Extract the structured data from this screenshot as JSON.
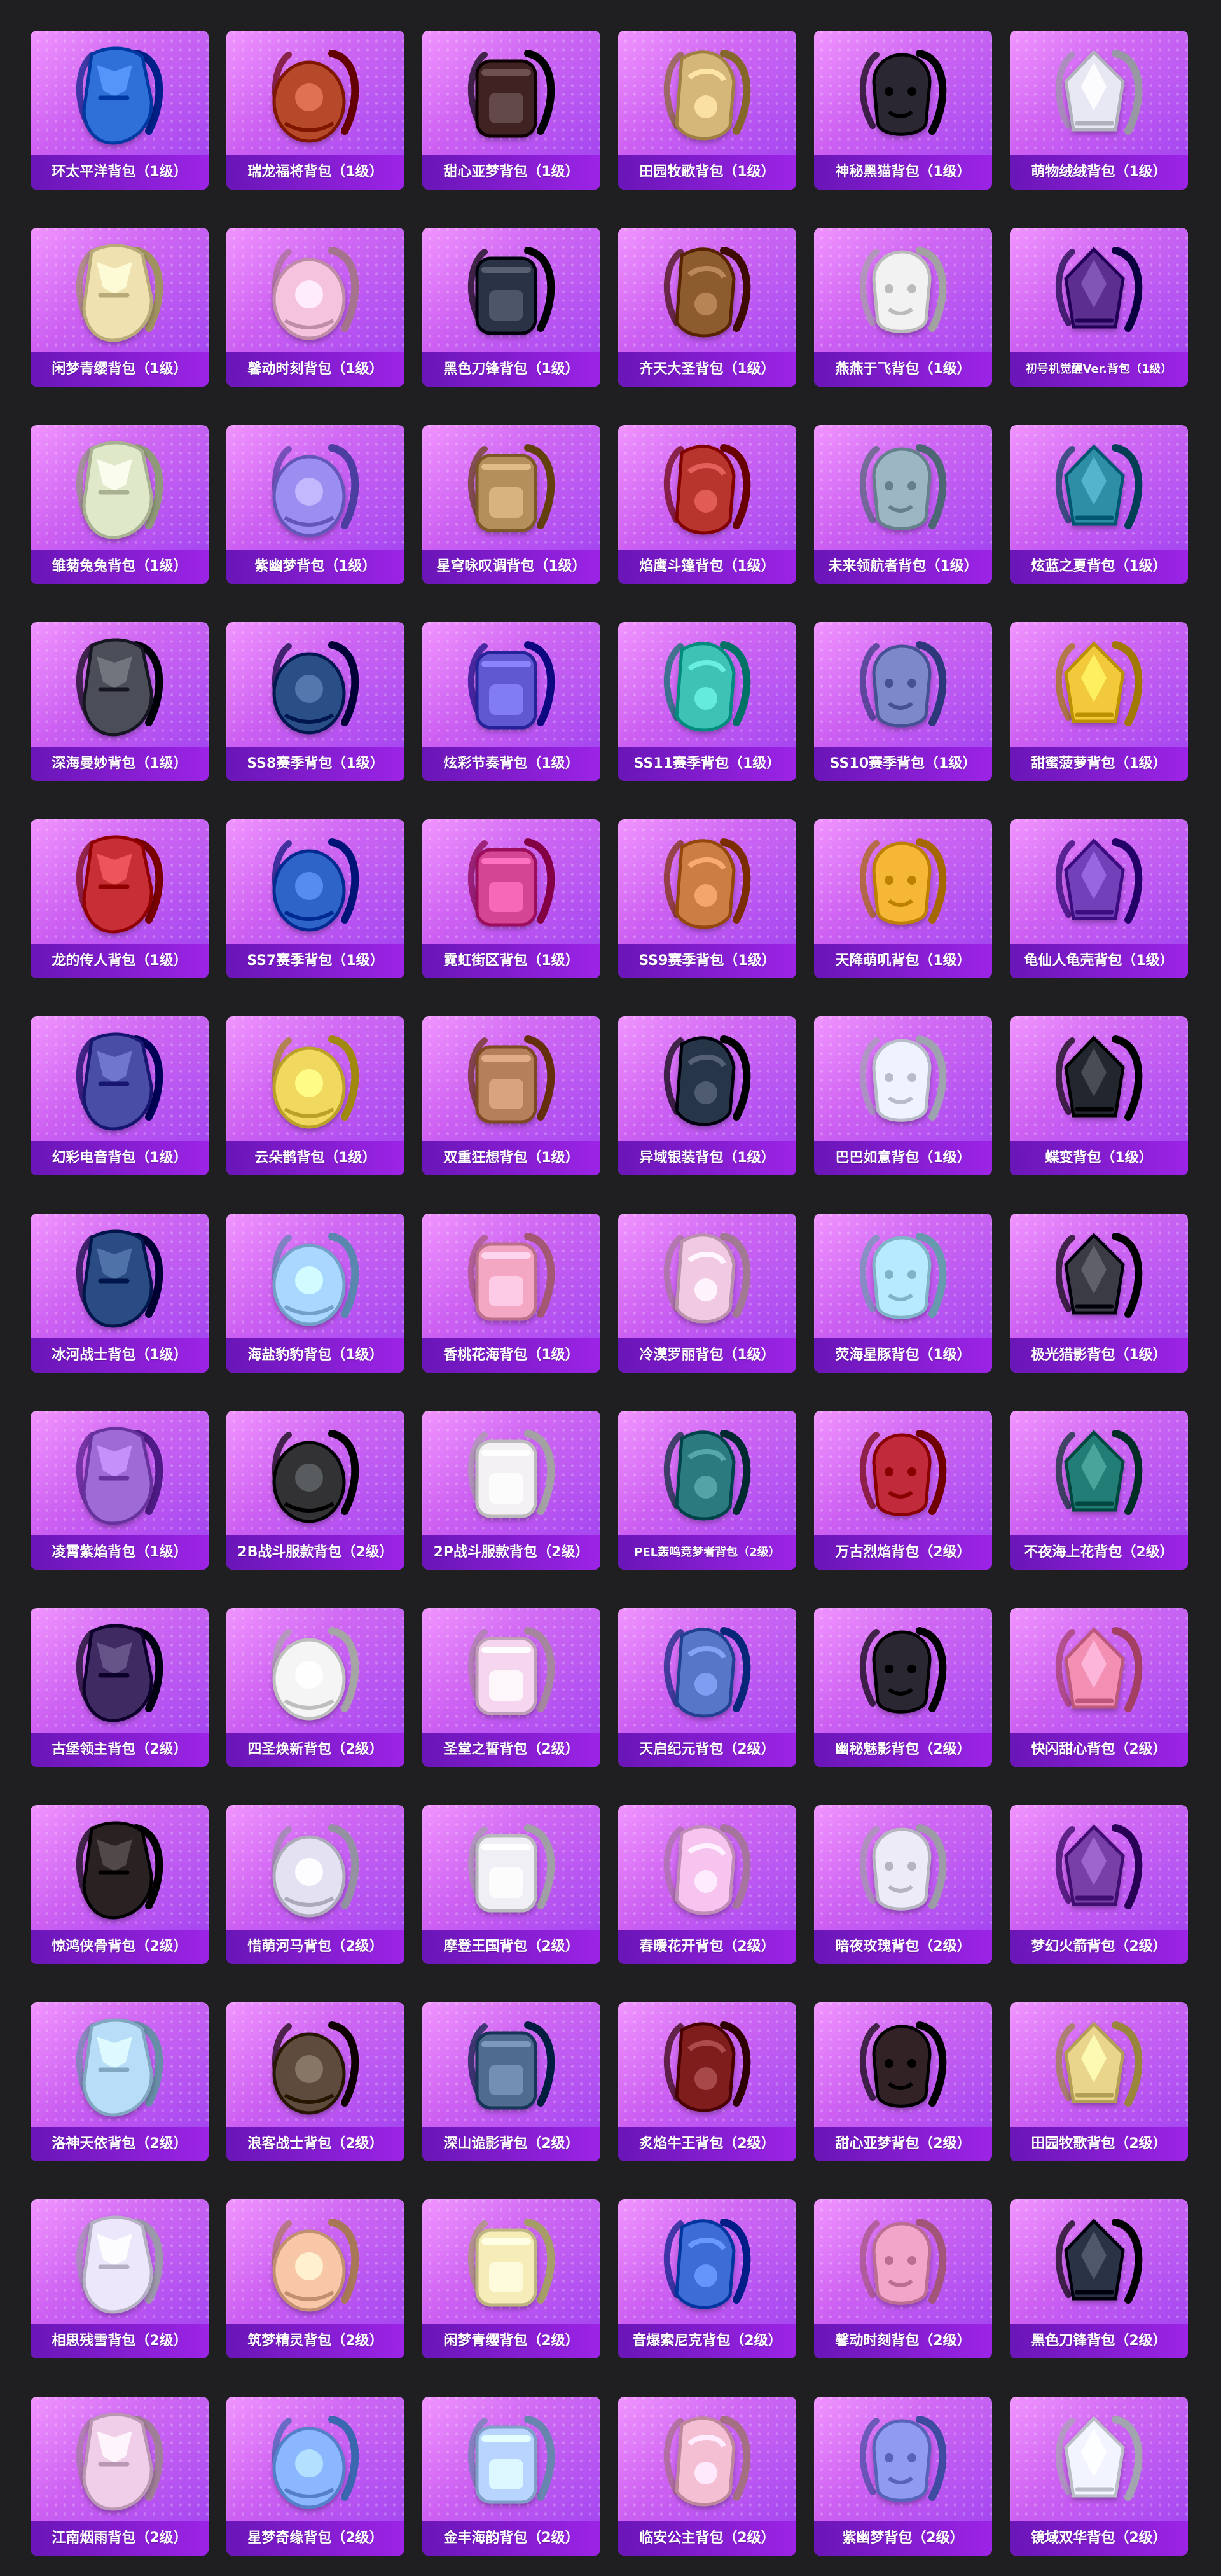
{
  "items": [
    {
      "label": "环太平洋背包（1级）",
      "icon": "armored-backpack-icon",
      "accent": "#2f6fd8"
    },
    {
      "label": "瑞龙福将背包（1级）",
      "icon": "dragon-backpack-icon",
      "accent": "#b54a2b"
    },
    {
      "label": "甜心亚梦背包（1级）",
      "icon": "cat-backpack-icon",
      "accent": "#402424"
    },
    {
      "label": "田园牧歌背包（1级）",
      "icon": "basket-backpack-icon",
      "accent": "#d6b77a"
    },
    {
      "label": "神秘黑猫背包（1级）",
      "icon": "black-cat-backpack-icon",
      "accent": "#2c2830"
    },
    {
      "label": "萌物绒绒背包（1级）",
      "icon": "plush-backpack-icon",
      "accent": "#e8e8f5"
    },
    {
      "label": "闲梦青缨背包（1级）",
      "icon": "tassel-backpack-icon",
      "accent": "#f0e2b0"
    },
    {
      "label": "馨动时刻背包（1级）",
      "icon": "bunny-backpack-icon",
      "accent": "#f5c3dd"
    },
    {
      "label": "黑色刀锋背包（1级）",
      "icon": "blade-backpack-icon",
      "accent": "#2b3244"
    },
    {
      "label": "齐天大圣背包（1级）",
      "icon": "monkey-king-backpack-icon",
      "accent": "#8d5b2d"
    },
    {
      "label": "燕燕于飞背包（1级）",
      "icon": "swallow-backpack-icon",
      "accent": "#f2f2f2"
    },
    {
      "label": "初号机觉醒Ver.背包（1级）",
      "icon": "mecha-backpack-icon",
      "accent": "#5b2f8f"
    },
    {
      "label": "雏菊兔兔背包（1级）",
      "icon": "daisy-bunny-backpack-icon",
      "accent": "#dfe8c8"
    },
    {
      "label": "紫幽梦背包（1级）",
      "icon": "purple-orb-backpack-icon",
      "accent": "#9b8ef0"
    },
    {
      "label": "星穹咏叹调背包（1级）",
      "icon": "golden-backpack-icon",
      "accent": "#b38f5c"
    },
    {
      "label": "焰鹰斗篷背包（1级）",
      "icon": "flame-cape-backpack-icon",
      "accent": "#b8342d"
    },
    {
      "label": "未来领航者背包（1级）",
      "icon": "future-pilot-backpack-icon",
      "accent": "#9db6c4"
    },
    {
      "label": "炫蓝之夏背包（1级）",
      "icon": "blue-summer-backpack-icon",
      "accent": "#2e8ea6"
    },
    {
      "label": "深海曼妙背包（1级）",
      "icon": "tank-backpack-icon",
      "accent": "#4b4e58"
    },
    {
      "label": "SS8赛季背包（1级）",
      "icon": "season-backpack-icon",
      "accent": "#2b4f86"
    },
    {
      "label": "炫彩节奏背包（1级）",
      "icon": "rhythm-backpack-icon",
      "accent": "#5e58d0"
    },
    {
      "label": "SS11赛季背包（1级）",
      "icon": "season-backpack-icon",
      "accent": "#3cc2b5"
    },
    {
      "label": "SS10赛季背包（1级）",
      "icon": "season-backpack-icon",
      "accent": "#7c88c9"
    },
    {
      "label": "甜蜜菠萝背包（1级）",
      "icon": "pineapple-backpack-icon",
      "accent": "#f1c93b"
    },
    {
      "label": "龙的传人背包（1级）",
      "icon": "red-school-backpack-icon",
      "accent": "#c82f34"
    },
    {
      "label": "SS7赛季背包（1级）",
      "icon": "season-backpack-icon",
      "accent": "#2e63c7"
    },
    {
      "label": "霓虹街区背包（1级）",
      "icon": "neon-backpack-icon",
      "accent": "#d44594"
    },
    {
      "label": "SS9赛季背包（1级）",
      "icon": "season-backpack-icon",
      "accent": "#cb7d42"
    },
    {
      "label": "天降萌叽背包（1级）",
      "icon": "yellow-backpack-icon",
      "accent": "#f5b735"
    },
    {
      "label": "龟仙人龟壳背包（1级）",
      "icon": "turtle-shell-backpack-icon",
      "accent": "#7240b8"
    },
    {
      "label": "幻彩电音背包（1级）",
      "icon": "speaker-backpack-icon",
      "accent": "#4a4ea6"
    },
    {
      "label": "云朵鹊背包（1级）",
      "icon": "flower-backpack-icon",
      "accent": "#f1d95f"
    },
    {
      "label": "双重狂想背包（1级）",
      "icon": "fox-backpack-icon",
      "accent": "#b47f5a"
    },
    {
      "label": "异域银装背包（1级）",
      "icon": "silver-backpack-icon",
      "accent": "#273447"
    },
    {
      "label": "巴巴如意背包（1级）",
      "icon": "white-bunny-backpack-icon",
      "accent": "#eef3ff"
    },
    {
      "label": "蝶变背包（1级）",
      "icon": "butterfly-backpack-icon",
      "accent": "#23252f"
    },
    {
      "label": "冰河战士背包（1级）",
      "icon": "ice-warrior-backpack-icon",
      "accent": "#2a4c83"
    },
    {
      "label": "海盐豹豹背包（1级）",
      "icon": "seal-backpack-icon",
      "accent": "#a9d7ff"
    },
    {
      "label": "香桃花海背包（1级）",
      "icon": "peach-backpack-icon",
      "accent": "#f4a7c2"
    },
    {
      "label": "冷漠罗丽背包（1级）",
      "icon": "ribbon-backpack-icon",
      "accent": "#f2c9e2"
    },
    {
      "label": "荧海星豚背包（1级）",
      "icon": "dolphin-backpack-icon",
      "accent": "#b8eaff"
    },
    {
      "label": "极光猎影背包（1级）",
      "icon": "shadow-backpack-icon",
      "accent": "#3b3b45"
    },
    {
      "label": "凌霄紫焰背包（1级）",
      "icon": "purple-flame-backpack-icon",
      "accent": "#9e6ad5"
    },
    {
      "label": "2B战斗服款背包（2级）",
      "icon": "combat-backpack-icon",
      "accent": "#303236"
    },
    {
      "label": "2P战斗服款背包（2级）",
      "icon": "white-combat-backpack-icon",
      "accent": "#f4f1f4"
    },
    {
      "label": "PEL轰鸣竞梦者背包（2级）",
      "icon": "esports-backpack-icon",
      "accent": "#2a7a7f"
    },
    {
      "label": "万古烈焰背包（2级）",
      "icon": "red-armor-backpack-icon",
      "accent": "#c02b3a"
    },
    {
      "label": "不夜海上花背包（2级）",
      "icon": "teal-flower-backpack-icon",
      "accent": "#227d76"
    },
    {
      "label": "古堡领主背包（2级）",
      "icon": "castle-lord-backpack-icon",
      "accent": "#402c62"
    },
    {
      "label": "四圣焕新背包（2级）",
      "icon": "robot-backpack-icon",
      "accent": "#f5f5f5"
    },
    {
      "label": "圣堂之誓背包（2级）",
      "icon": "heart-backpack-icon",
      "accent": "#f6d5ef"
    },
    {
      "label": "天启纪元背包（2级）",
      "icon": "tech-backpack-icon",
      "accent": "#5776c8"
    },
    {
      "label": "幽秘魅影背包（2级）",
      "icon": "gothic-backpack-icon",
      "accent": "#2a2732"
    },
    {
      "label": "快闪甜心背包（2级）",
      "icon": "pink-robot-backpack-icon",
      "accent": "#f28fb3"
    },
    {
      "label": "惊鸿侠骨背包（2级）",
      "icon": "dark-armor-backpack-icon",
      "accent": "#2b2424"
    },
    {
      "label": "惜萌河马背包（2级）",
      "icon": "hippo-backpack-icon",
      "accent": "#e4e2f2"
    },
    {
      "label": "摩登王国背包（2级）",
      "icon": "bear-backpack-icon",
      "accent": "#efeff5"
    },
    {
      "label": "春暖花开背包（2级）",
      "icon": "pastel-flower-backpack-icon",
      "accent": "#f6c4ef"
    },
    {
      "label": "暗夜玫瑰背包（2级）",
      "icon": "rose-bunny-backpack-icon",
      "accent": "#ecebf7"
    },
    {
      "label": "梦幻火箭背包（2级）",
      "icon": "rocket-backpack-icon",
      "accent": "#7840a6"
    },
    {
      "label": "洛神天依背包（2级）",
      "icon": "crystal-backpack-icon",
      "accent": "#b8ddf8"
    },
    {
      "label": "浪客战士背包（2级）",
      "icon": "wanderer-backpack-icon",
      "accent": "#5f4c3c"
    },
    {
      "label": "深山诡影背包（2级）",
      "icon": "mountain-backpack-icon",
      "accent": "#4f6c8f"
    },
    {
      "label": "炙焰牛王背包（2级）",
      "icon": "bull-backpack-icon",
      "accent": "#7f1f1f"
    },
    {
      "label": "甜心亚梦背包（2级）",
      "icon": "cat-backpack-icon",
      "accent": "#322426"
    },
    {
      "label": "田园牧歌背包（2级）",
      "icon": "basket-backpack-icon",
      "accent": "#ead58c"
    },
    {
      "label": "相思残雪背包（2级）",
      "icon": "snow-backpack-icon",
      "accent": "#ece7fb"
    },
    {
      "label": "筑梦精灵背包（2级）",
      "icon": "fairy-backpack-icon",
      "accent": "#f7c7a7"
    },
    {
      "label": "闲梦青缨背包（2级）",
      "icon": "tassel-backpack-icon",
      "accent": "#f5ecb7"
    },
    {
      "label": "音爆索尼克背包（2级）",
      "icon": "sonic-backpack-icon",
      "accent": "#3c6cd6"
    },
    {
      "label": "馨动时刻背包（2级）",
      "icon": "pink-bunny-backpack-icon",
      "accent": "#f3a5c9"
    },
    {
      "label": "黑色刀锋背包（2级）",
      "icon": "blade-backpack-icon",
      "accent": "#2a3345"
    },
    {
      "label": "江南烟雨背包（2级）",
      "icon": "rain-bunny-backpack-icon",
      "accent": "#f0cde8"
    },
    {
      "label": "星梦奇缘背包（2级）",
      "icon": "swan-backpack-icon",
      "accent": "#8ab7ff"
    },
    {
      "label": "金丰海韵背包（2级）",
      "icon": "sea-backpack-icon",
      "accent": "#b8d5ff"
    },
    {
      "label": "临安公主背包（2级）",
      "icon": "princess-backpack-icon",
      "accent": "#f4bfd2"
    },
    {
      "label": "紫幽梦背包（2级）",
      "icon": "purple-orb-backpack-icon",
      "accent": "#8e9bf0"
    },
    {
      "label": "镜域双华背包（2级）",
      "icon": "mirror-heart-backpack-icon",
      "accent": "#f2f5ff"
    }
  ]
}
